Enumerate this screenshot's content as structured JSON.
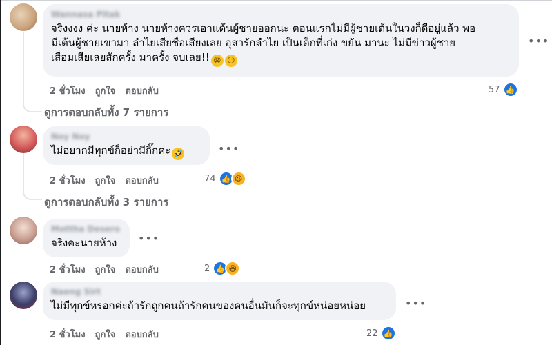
{
  "comments": [
    {
      "name": "Wannasa Pitak",
      "text": "จริงงงง ค่ะ นายห้าง นายห้างควรเอาแด้นผู้ชายออกนะ ตอนแรกไม่มีผู้ชายเต้นในวงก็ดีอยู่แล้ว พอ\nมีเต้นผู้ชายเขามา ลำไยเสียชื่อเสียงเลย อุสารักลำไย เป็นเด็กที่เก่ง ขยัน มานะ ไม่มีข่าวผู้ชาย\nเสื่อมเสียเลยสักครั้ง มาครั้ง จบเลย!!",
      "emojis": [
        "😩",
        "😑"
      ],
      "time": "2 ชั่วโมง",
      "like": "ถูกใจ",
      "reply": "ตอบกลับ",
      "reactions": "57",
      "view_replies": "ดูการตอบกลับทั้ง 7 รายการ",
      "avatar_color": "#c9a27a"
    },
    {
      "name": "Noy Noy",
      "text": "ไม่อยากมีทุกข์ก็อย่ามีกิ๊กค่ะ",
      "emojis": [
        "🤣"
      ],
      "time": "2 ชั่วโมง",
      "like": "ถูกใจ",
      "reply": "ตอบกลับ",
      "reactions": "74",
      "view_replies": "ดูการตอบกลับทั้ง 3 รายการ",
      "avatar_color": "#d45a5a"
    },
    {
      "name": "Mottha Desero",
      "text": "จริงคะนายห้าง",
      "emojis": [],
      "time": "2 ชั่วโมง",
      "like": "ถูกใจ",
      "reply": "ตอบกลับ",
      "reactions": "2",
      "avatar_color": "#c89f92"
    },
    {
      "name": "Naeng Sirt",
      "text": "ไม่มีทุกข์หรอกค่ะถ้ารักถูกคนถ้ารักคนของคนอื่นมันก็จะทุกข์หน่อยหน่อย",
      "emojis": [],
      "time": "2 ชั่วโมง",
      "like": "ถูกใจ",
      "reply": "ตอบกลับ",
      "reactions": "22",
      "avatar_color": "#3b3f6a"
    }
  ],
  "icons": {
    "more": "ellipsis-icon",
    "like": "like-icon",
    "haha": "haha-icon"
  },
  "colors": {
    "bubble": "#f0f2f5",
    "like_blue": "#1b74e4",
    "muted": "#65676b"
  }
}
